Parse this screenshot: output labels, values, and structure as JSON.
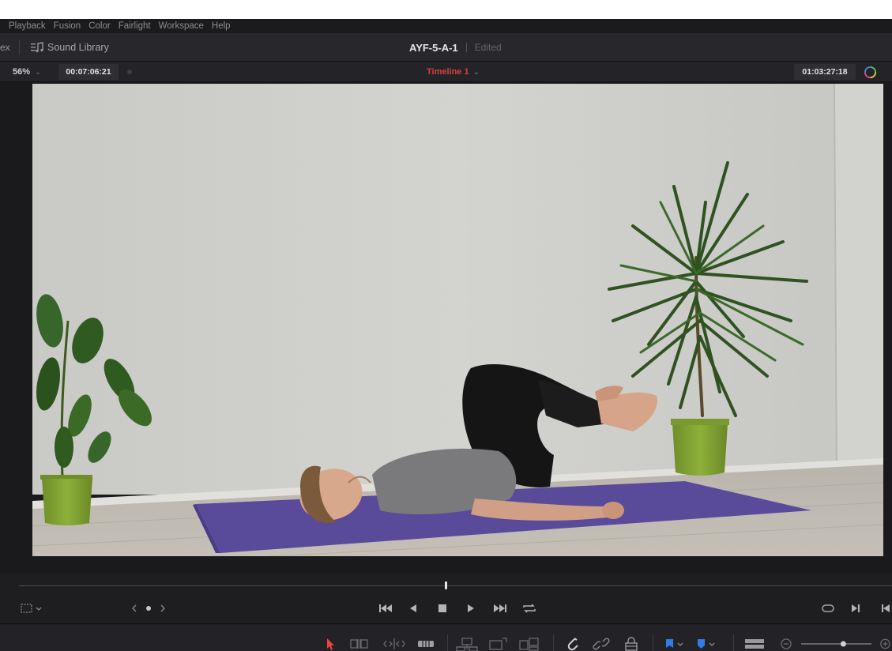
{
  "menu": [
    "Playback",
    "Fusion",
    "Color",
    "Fairlight",
    "Workspace",
    "Help"
  ],
  "titlebar": {
    "cut_text": "ex",
    "sound_library": "Sound Library",
    "project_name": "AYF-5-A-1",
    "status": "Edited"
  },
  "viewer": {
    "zoom": "56%",
    "source_timecode": "00:07:06:21",
    "timeline_name": "Timeline 1",
    "record_timecode": "01:03:27:18"
  },
  "icons": {
    "sound_library": "sound-library-icon",
    "transport": [
      "go-to-start-icon",
      "play-reverse-icon",
      "stop-icon",
      "play-icon",
      "go-to-end-icon",
      "loop-icon"
    ],
    "toolbar": [
      "selection-tool-icon",
      "trim-tool-icon",
      "dynamic-trim-icon",
      "blade-tool-icon",
      "insert-clip-icon",
      "overwrite-clip-icon",
      "replace-clip-icon",
      "snapping-icon",
      "linked-selection-icon",
      "position-lock-icon",
      "flag-icon",
      "marker-icon",
      "timeline-view-icon",
      "zoom-out-icon",
      "zoom-in-icon"
    ]
  },
  "colors": {
    "timeline_name": "#d6403c",
    "selection_tool": "#e8463a",
    "flag": "#2e7de8",
    "playhead": "#e04a3a"
  },
  "zoom_slider_level": 0.4
}
